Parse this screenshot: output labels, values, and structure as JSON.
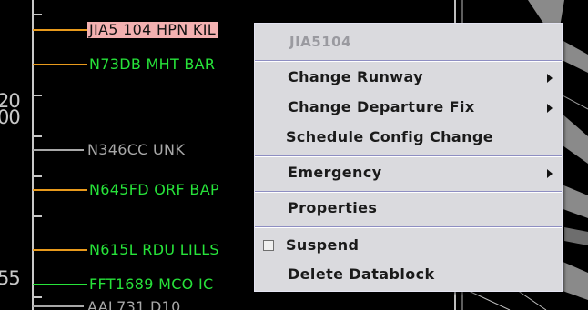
{
  "scope": {
    "altitude_labels": [
      "20",
      "00",
      "55"
    ],
    "flights": [
      {
        "id": "fl-jia5104",
        "text": "JIA5 104 HPN KIL",
        "status": "selected"
      },
      {
        "id": "fl-n73db",
        "text": "N73DB MHT BAR",
        "status": "active"
      },
      {
        "id": "fl-n346cc",
        "text": "N346CC UNK",
        "status": "inactive"
      },
      {
        "id": "fl-n645fd",
        "text": "N645FD ORF BAP",
        "status": "active"
      },
      {
        "id": "fl-n615l",
        "text": "N615L RDU LILLS",
        "status": "active"
      },
      {
        "id": "fl-fft1689",
        "text": "FFT1689 MCO IC",
        "status": "active"
      },
      {
        "id": "fl-aal731",
        "text": "AAL731 D10",
        "status": "inactive"
      }
    ],
    "colors": {
      "active": "#27e33a",
      "inactive": "#a8a8a8",
      "selected_bg": "#f3b1b1",
      "leader": "#e89a1c"
    }
  },
  "context_menu": {
    "header": "JIA5104",
    "items": [
      {
        "label": "Change Runway",
        "submenu": true
      },
      {
        "label": "Change Departure Fix",
        "submenu": true
      },
      {
        "label": "Schedule Config Change",
        "submenu": false
      },
      {
        "label": "Emergency",
        "submenu": true
      },
      {
        "label": "Properties",
        "submenu": false
      },
      {
        "label": "Suspend",
        "submenu": false,
        "checkbox": true,
        "checked": false
      },
      {
        "label": "Delete Datablock",
        "submenu": false
      }
    ]
  }
}
